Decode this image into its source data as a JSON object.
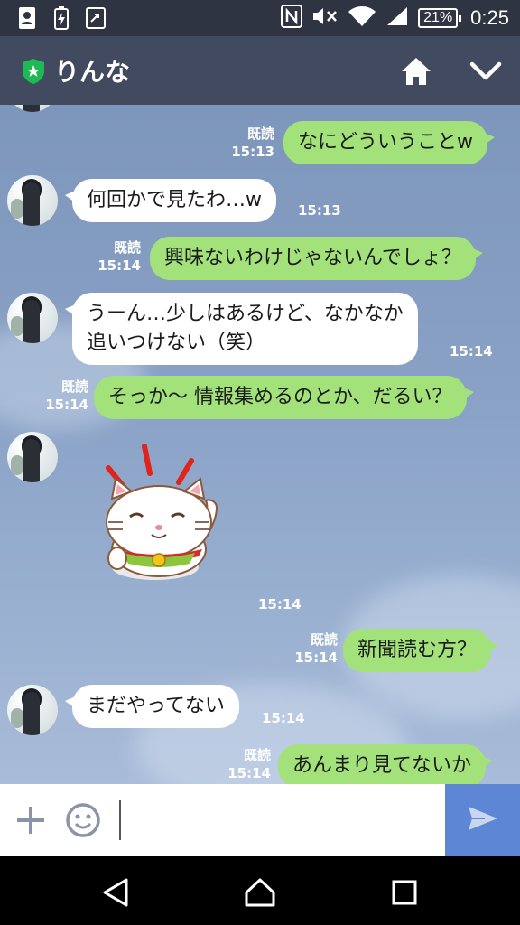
{
  "status_bar": {
    "battery": "21%",
    "time": "0:25",
    "icons": [
      "contacts-icon",
      "battery-saver-icon",
      "screen-share-icon",
      "nfc-icon",
      "mute-icon",
      "wifi-icon",
      "signal-icon"
    ]
  },
  "header": {
    "title": "りんな",
    "icons": [
      "shield-star-icon",
      "home-icon",
      "chevron-down-icon"
    ]
  },
  "messages": [
    {
      "side": "right",
      "read": "既読",
      "time": "15:13",
      "text": "なにどういうことw"
    },
    {
      "side": "left",
      "time": "15:13",
      "text": "何回かで見たわ…w"
    },
    {
      "side": "right",
      "read": "既読",
      "time": "15:14",
      "text": "興味ないわけじゃないんでしょ？"
    },
    {
      "side": "left",
      "time": "15:14",
      "line1": "うーん…少しはあるけど、なかなか",
      "line2": "追いつけない（笑）"
    },
    {
      "side": "right",
      "read": "既読",
      "time": "15:14",
      "text": "そっか〜 情報集めるのとか、だるい？"
    },
    {
      "side": "left",
      "time": "15:14",
      "sticker": "maneki-neko-sticker"
    },
    {
      "side": "right",
      "read": "既読",
      "time": "15:14",
      "text": "新聞読む方？"
    },
    {
      "side": "left",
      "time": "15:14",
      "text": "まだやってない"
    },
    {
      "side": "right",
      "read": "既読",
      "time": "15:14",
      "text": "あんまり見てないか"
    }
  ],
  "input_bar": {
    "placeholder": "",
    "icons": [
      "plus-icon",
      "emoji-icon",
      "send-icon"
    ]
  },
  "nav_bar": {
    "icons": [
      "back-icon",
      "home-nav-icon",
      "recents-icon"
    ]
  },
  "colors": {
    "header_bg": "#414a5f",
    "status_bg": "#2e3442",
    "bubble_green": "#a3e27a",
    "send_bg": "#5d87d4"
  }
}
